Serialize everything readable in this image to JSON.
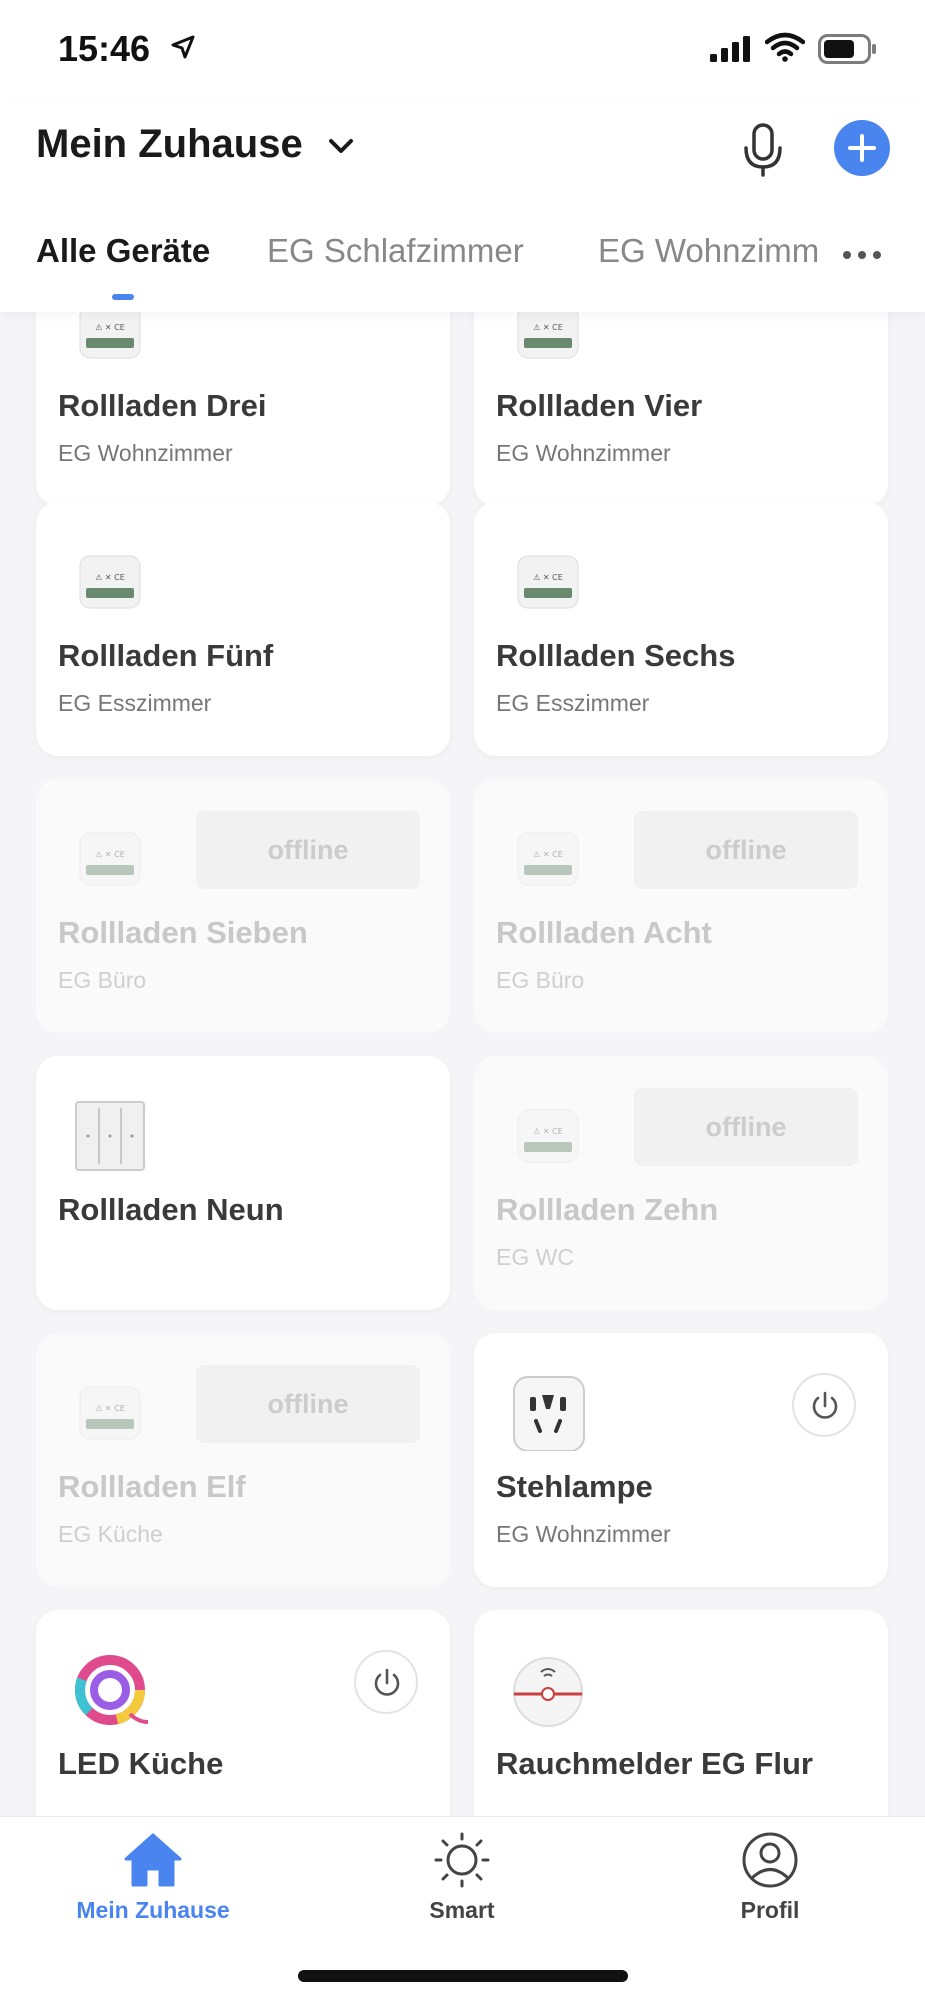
{
  "status_bar": {
    "time": "15:46"
  },
  "header": {
    "home_title": "Mein Zuhause",
    "tabs": [
      {
        "label": "Alle Geräte",
        "active": true
      },
      {
        "label": "EG Schlafzimmer",
        "active": false
      },
      {
        "label": "EG Wohnzimmer",
        "active": false
      }
    ]
  },
  "devices": [
    {
      "name": "Rollladen Drei",
      "room": "EG Wohnzimmer",
      "icon": "curtain-module-icon",
      "offline": false
    },
    {
      "name": "Rollladen Vier",
      "room": "EG Wohnzimmer",
      "icon": "curtain-module-icon",
      "offline": false
    },
    {
      "name": "Rollladen Fünf",
      "room": "EG Esszimmer",
      "icon": "curtain-module-icon",
      "offline": false
    },
    {
      "name": "Rollladen Sechs",
      "room": "EG Esszimmer",
      "icon": "curtain-module-icon",
      "offline": false
    },
    {
      "name": "Rollladen Sieben",
      "room": "EG Büro",
      "icon": "curtain-module-icon",
      "offline": true,
      "badge": "offline"
    },
    {
      "name": "Rollladen Acht",
      "room": "EG Büro",
      "icon": "curtain-module-icon",
      "offline": true,
      "badge": "offline"
    },
    {
      "name": "Rollladen Neun",
      "room": "",
      "icon": "wall-switch-icon",
      "offline": false
    },
    {
      "name": "Rollladen Zehn",
      "room": "EG WC",
      "icon": "curtain-module-icon",
      "offline": true,
      "badge": "offline"
    },
    {
      "name": "Rollladen Elf",
      "room": "EG Küche",
      "icon": "curtain-module-icon",
      "offline": true,
      "badge": "offline"
    },
    {
      "name": "Stehlampe",
      "room": "EG Wohnzimmer",
      "icon": "smart-plug-icon",
      "offline": false,
      "power": true
    },
    {
      "name": "LED Küche",
      "room": "",
      "icon": "led-strip-icon",
      "offline": false,
      "power": true
    },
    {
      "name": "Rauchmelder EG Flur",
      "room": "",
      "icon": "smoke-detector-icon",
      "offline": false
    }
  ],
  "tab_bar": [
    {
      "label": "Mein Zuhause",
      "icon": "home-icon",
      "active": true
    },
    {
      "label": "Smart",
      "icon": "sun-icon",
      "active": false
    },
    {
      "label": "Profil",
      "icon": "profile-icon",
      "active": false
    }
  ],
  "colors": {
    "accent": "#4a84ee",
    "background": "#f5f5f7"
  }
}
